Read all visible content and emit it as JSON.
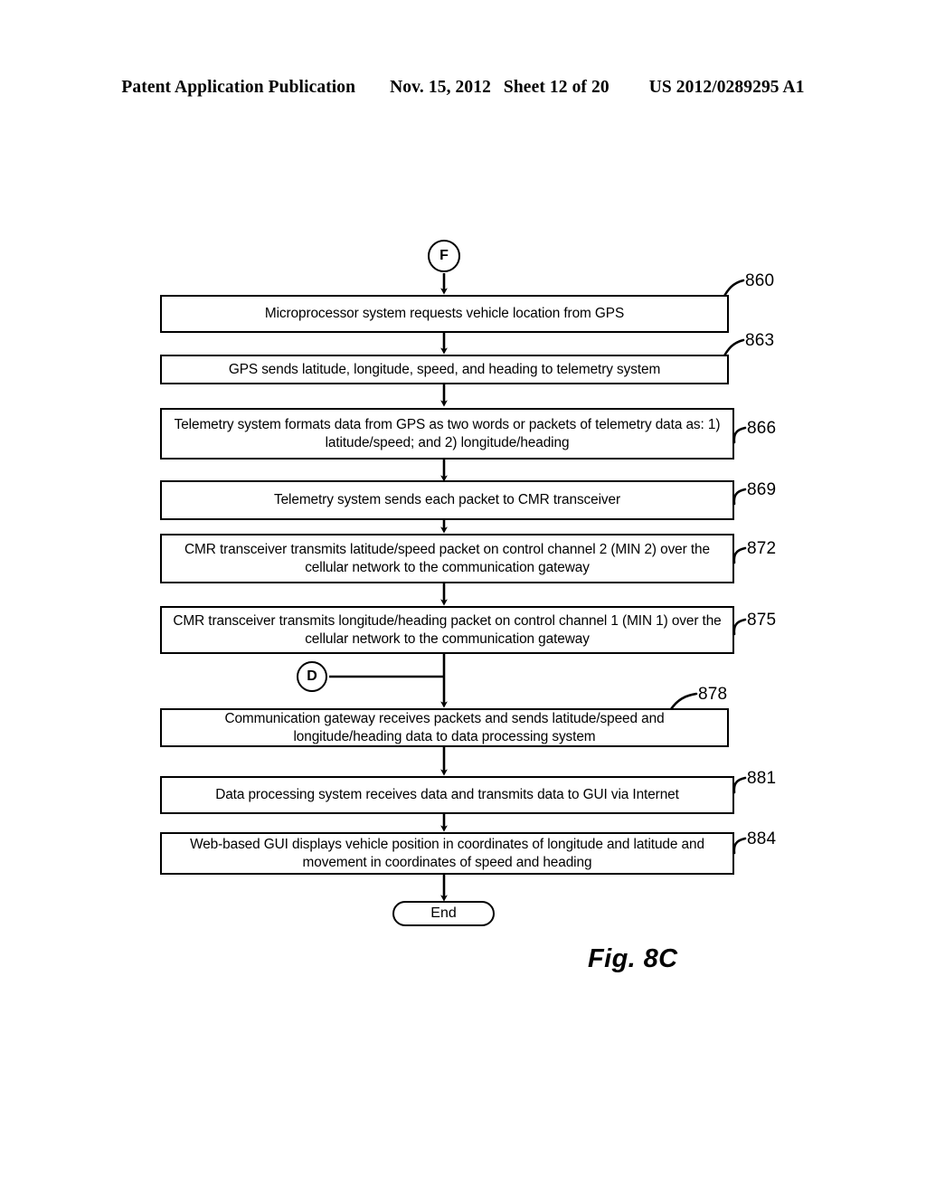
{
  "header": {
    "publication": "Patent Application Publication",
    "date": "Nov. 15, 2012",
    "sheet": "Sheet 12 of 20",
    "number": "US 2012/0289295 A1"
  },
  "figure": {
    "caption": "Fig. 8C",
    "entry_connector": "F",
    "side_connector": "D",
    "terminator": "End"
  },
  "steps": [
    {
      "ref": "860",
      "text": "Microprocessor system requests vehicle location from GPS"
    },
    {
      "ref": "863",
      "text": "GPS sends latitude, longitude, speed, and heading to telemetry system"
    },
    {
      "ref": "866",
      "text": "Telemetry system formats data from GPS as two words or packets of telemetry data as:  1) latitude/speed; and 2) longitude/heading"
    },
    {
      "ref": "869",
      "text": "Telemetry system sends each packet to CMR transceiver"
    },
    {
      "ref": "872",
      "text": "CMR transceiver transmits latitude/speed packet on control channel 2 (MIN 2) over the cellular network to the communication gateway"
    },
    {
      "ref": "875",
      "text": "CMR transceiver transmits longitude/heading packet on control channel 1 (MIN 1) over the cellular network to the communication gateway"
    },
    {
      "ref": "878",
      "text": "Communication gateway receives packets and sends latitude/speed and longitude/heading data to data processing system"
    },
    {
      "ref": "881",
      "text": "Data processing system receives data and transmits data to GUI via Internet"
    },
    {
      "ref": "884",
      "text": "Web-based GUI displays vehicle position in coordinates of longitude and latitude and movement in coordinates of speed and heading"
    }
  ],
  "colors": {
    "ink": "#000000",
    "paper": "#ffffff"
  }
}
